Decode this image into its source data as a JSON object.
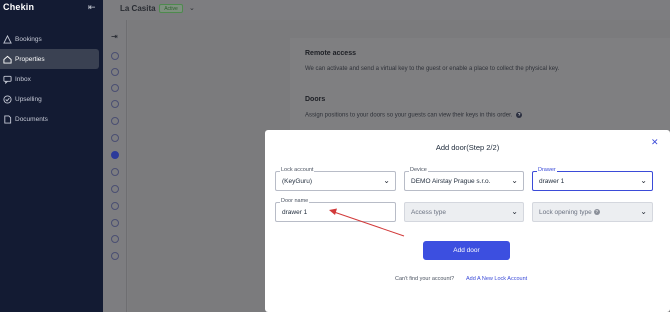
{
  "sidebar": {
    "brand": "Chekin",
    "items": [
      {
        "label": "Bookings",
        "icon": "triangle-icon"
      },
      {
        "label": "Properties",
        "icon": "home-icon",
        "active": true
      },
      {
        "label": "Inbox",
        "icon": "chat-icon"
      },
      {
        "label": "Upselling",
        "icon": "check-circle-icon"
      },
      {
        "label": "Documents",
        "icon": "document-icon"
      }
    ]
  },
  "header": {
    "property_name": "La Casita",
    "status": "Active"
  },
  "background": {
    "remote_access_title": "Remote access",
    "remote_access_desc": "We can activate and send a virtual key to the guest or enable a place to collect the physical key.",
    "doors_title": "Doors",
    "doors_desc": "Assign positions to your doors so your guests can view their keys in this order."
  },
  "modal": {
    "title": "Add door(Step 2/2)",
    "lock_account": {
      "label": "Lock account",
      "value": "(KeyGuru)"
    },
    "device": {
      "label": "Device",
      "value": "DEMO Airstay Prague s.r.o."
    },
    "drawer": {
      "label": "Drawer",
      "value": "drawer 1"
    },
    "door_name": {
      "label": "Door name",
      "value": "drawer 1"
    },
    "access_type": {
      "placeholder": "Access type"
    },
    "lock_opening_type": {
      "placeholder": "Lock opening type"
    },
    "add_door_label": "Add door",
    "cant_find_text": "Can't find your account?",
    "add_lock_link": "Add A New Lock Account"
  },
  "colors": {
    "sidebar_bg": "#131b33",
    "accent": "#3c4fe0",
    "annotation_arrow": "#d23a3a"
  }
}
